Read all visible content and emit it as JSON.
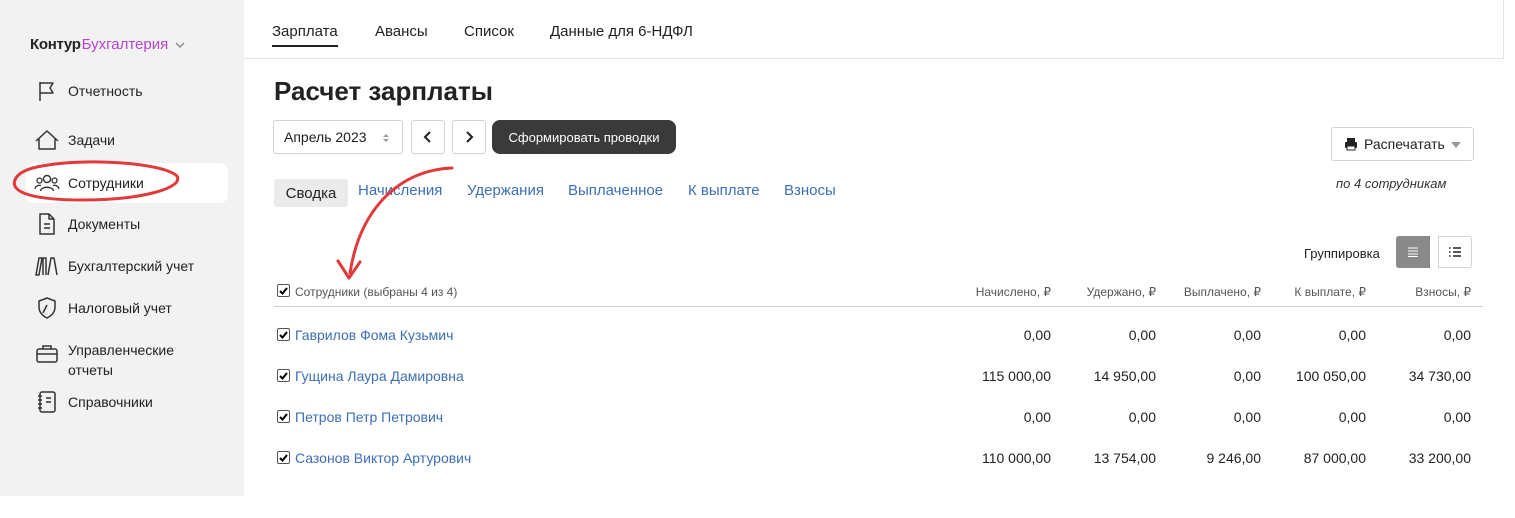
{
  "brand": {
    "part1": "Контур",
    "part2": "Бухгалтерия"
  },
  "sidebar": {
    "items": [
      {
        "label": "Отчетность"
      },
      {
        "label": "Задачи"
      },
      {
        "label": "Сотрудники"
      },
      {
        "label": "Документы"
      },
      {
        "label": "Бухгалтерский учет"
      },
      {
        "label": "Налоговый учет"
      },
      {
        "label": "Управленческие отчеты"
      },
      {
        "label": "Справочники"
      }
    ]
  },
  "tabs": [
    {
      "label": "Зарплата"
    },
    {
      "label": "Авансы"
    },
    {
      "label": "Список"
    },
    {
      "label": "Данные для 6-НДФЛ"
    }
  ],
  "page": {
    "title": "Расчет зарплаты",
    "period": "Апрель 2023",
    "generate_button": "Сформировать проводки",
    "print_button": "Распечатать",
    "print_note": "по 4 сотрудникам",
    "grouping_label": "Группировка"
  },
  "subtabs": [
    {
      "label": "Сводка"
    },
    {
      "label": "Начисления"
    },
    {
      "label": "Удержания"
    },
    {
      "label": "Выплаченное"
    },
    {
      "label": "К выплате"
    },
    {
      "label": "Взносы"
    }
  ],
  "table": {
    "columns": {
      "employees": "Сотрудники (выбраны 4 из 4)",
      "accrued": "Начислено, ₽",
      "withheld": "Удержано, ₽",
      "paid": "Выплачено, ₽",
      "to_pay": "К выплате, ₽",
      "contributions": "Взносы, ₽"
    },
    "rows": [
      {
        "name": "Гаврилов Фома Кузьмич",
        "accrued": "0,00",
        "withheld": "0,00",
        "paid": "0,00",
        "to_pay": "0,00",
        "contributions": "0,00"
      },
      {
        "name": "Гущина Лаура Дамировна",
        "accrued": "115 000,00",
        "withheld": "14 950,00",
        "paid": "0,00",
        "to_pay": "100 050,00",
        "contributions": "34 730,00"
      },
      {
        "name": "Петров Петр Петрович",
        "accrued": "0,00",
        "withheld": "0,00",
        "paid": "0,00",
        "to_pay": "0,00",
        "contributions": "0,00"
      },
      {
        "name": "Сазонов Виктор Артурович",
        "accrued": "110 000,00",
        "withheld": "13 754,00",
        "paid": "9 246,00",
        "to_pay": "87 000,00",
        "contributions": "33 200,00"
      }
    ]
  },
  "colors": {
    "brand_accent": "#b645d0",
    "link": "#3d6fb6",
    "annotation": "#e03a3a"
  }
}
